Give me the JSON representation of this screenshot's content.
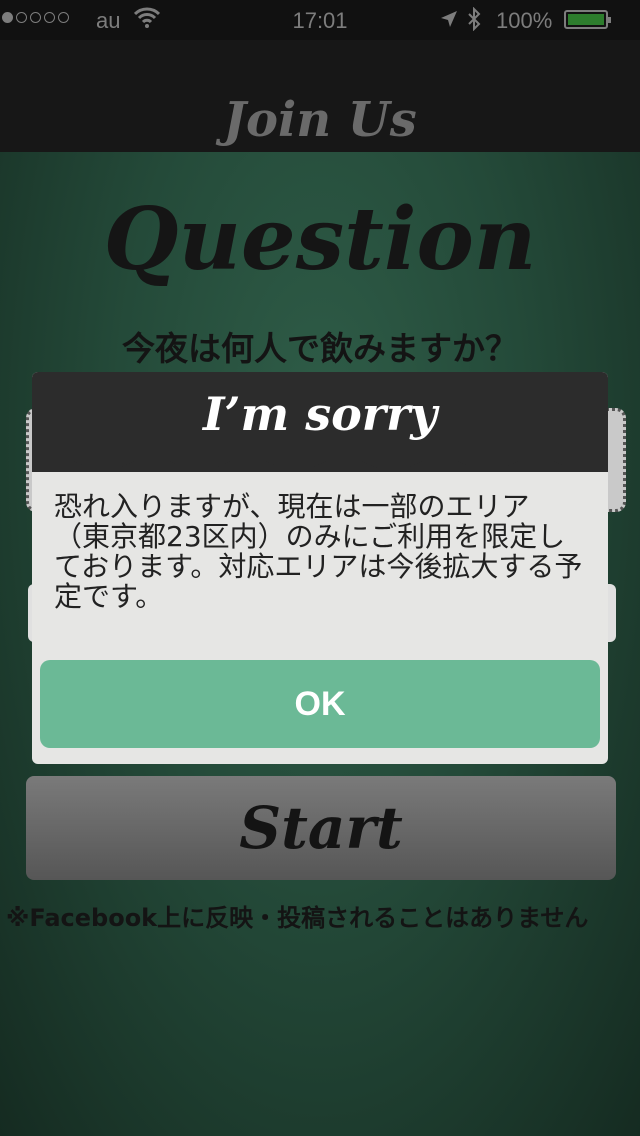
{
  "status_bar": {
    "carrier": "au",
    "time": "17:01",
    "battery": "100%"
  },
  "nav": {
    "title": "Join Us"
  },
  "question": {
    "heading": "Question",
    "text": "今夜は何人で飲みますか？"
  },
  "start_label": "Start",
  "disclaimer": "※Facebook上に反映・投稿されることはありません",
  "dialog": {
    "title": "I’m sorry",
    "message": "恐れ入りますが、現在は一部のエリア（東京都23区内）のみにご利用を限定しております。対応エリアは今後拡大する予定です。",
    "ok_label": "OK"
  },
  "colors": {
    "accent": "#6bb996",
    "header_dark": "#2c2c2c",
    "background_green": "#244a39"
  }
}
